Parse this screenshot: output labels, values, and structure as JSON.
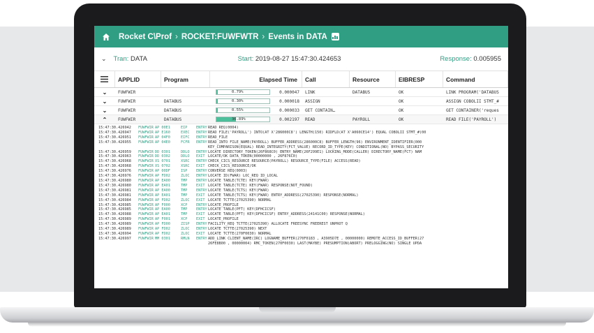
{
  "header": {
    "crumbs": [
      "Rocket C\\Prof",
      "ROCKET:FUWFWTR",
      "Events in DATA"
    ],
    "separator": "›"
  },
  "tran": {
    "tran_label": "Tran:",
    "tran_value": "DATA",
    "start_label": "Start:",
    "start_value": "2019-08-27 15:47:30.424653",
    "response_label": "Response:",
    "response_value": "0.005955"
  },
  "table": {
    "columns": [
      "APPLID",
      "Program",
      "Elapsed Time",
      "Call",
      "Resource",
      "EIBRESP",
      "Command"
    ],
    "rows": [
      {
        "toggle": "⌄",
        "applid": "FUWFWIR",
        "program": "",
        "pct_label": "0.79%",
        "pct": 0.0079,
        "elapsed": "0.000047",
        "call": "LINK",
        "resource": "DATABUS",
        "eibresp": "OK",
        "command": "LINK PROGRAM('DATABUS"
      },
      {
        "toggle": "⌄",
        "applid": "FUWFWIR",
        "program": "DATABUS",
        "pct_label": "0.30%",
        "pct": 0.003,
        "elapsed": "0.000018",
        "call": "ASSIGN",
        "resource": "",
        "eibresp": "OK",
        "command": "ASSIGN COBOLII STMT_#"
      },
      {
        "toggle": "⌄",
        "applid": "FUWFWIR",
        "program": "DATABUS",
        "pct_label": "0.55%",
        "pct": 0.0055,
        "elapsed": "0.000033",
        "call": "GET CONTAIN…",
        "resource": "",
        "eibresp": "OK",
        "command": "GET CONTAINER('reques"
      },
      {
        "toggle": "⌃",
        "applid": "FUWFWIR",
        "program": "DATABUS",
        "pct_label": "36.89%",
        "pct": 0.3689,
        "elapsed": "0.002197",
        "call": "READ",
        "resource": "PAYROLL",
        "eibresp": "OK",
        "command": "READ FILE('PAYROLL')"
      }
    ]
  },
  "log": [
    {
      "ts": "15:47:30.426942",
      "ap": "FUWFWIR",
      "dm": "AP 00E1",
      "op": "EIP",
      "ph": "ENTRY",
      "tx": "READ REQ(0004)"
    },
    {
      "ts": "15:47:30.426947",
      "ap": "FUWFWIR",
      "dm": "AP E160",
      "op": "EXEC",
      "ph": "ENTRY",
      "tx": "READ FILE('PAYROLL') INTO(AT X'286000C8') LENGTH(150) RIDFLD(AT X'A060CE14') EQUAL COBOLII STMT_#(00"
    },
    {
      "ts": "15:47:30.426951",
      "ap": "FUWFWIR",
      "dm": "AP 04F0",
      "op": "EIFC",
      "ph": "ENTRY",
      "tx": "READ_FILE"
    },
    {
      "ts": "15:47:30.426955",
      "ap": "FUWFWIR",
      "dm": "AP 04E0",
      "op": "FCFR",
      "ph": "ENTRY",
      "tx": "READ_INTO FILE_NAME(PAYROLL) BUFFER_ADDRESS(286000C8) BUFFER_LENGTH(96) ENVIRONMENT_IDENTIFIER(000"
    },
    {
      "cont": "KEY_COMPARISON(EQUAL) READ_INTEGRITY(FCT_VALUE) RECORD_ID_TYPE(KEY) CONDITIONAL(NO) BYPASS_SECURITY"
    },
    {
      "ts": "15:47:30.426959",
      "ap": "FUWFWIR",
      "dm": "DD 0301",
      "op": "DDLO",
      "ph": "ENTRY",
      "tx": "LOCATE DIRECTORY_TOKEN(26F868C0) ENTRY_NAME(26F299E1) LOCKING_MODE(CALLER) DIRECTORY_NAME(FCT) NAM"
    },
    {
      "ts": "15:47:30.426963",
      "ap": "FUWFWIR",
      "dm": "DD 0302",
      "op": "DDLO",
      "ph": "EXIT",
      "tx": "LOCATE/OK DATA_TOKEN(00000000 , 26F876C0)"
    },
    {
      "ts": "15:47:30.426968",
      "ap": "FUWFWIR",
      "dm": "XS 0701",
      "op": "XSRC",
      "ph": "ENTRY",
      "tx": "CHECK_CICS_RESOURCE RESOURCE(PAYROLL) RESOURCE_TYPE(FILE) ACCESS(READ)"
    },
    {
      "ts": "15:47:30.426968",
      "ap": "FUWFWIR",
      "dm": "XS 0702",
      "op": "XSRC",
      "ph": "EXIT",
      "tx": "CHECK_CICS_RESOURCE/OK"
    },
    {
      "ts": "15:47:30.426976",
      "ap": "FUWFWIR",
      "dm": "AP 00DF",
      "op": "ISP",
      "ph": "ENTRY",
      "tx": "CONVERSE REQ(0003)"
    },
    {
      "ts": "15:47:30.426976",
      "ap": "FUWFWIR",
      "dm": "AP FD02",
      "op": "ZLOC",
      "ph": "ENTRY",
      "tx": "LOCATE ID(FWAR) LOC_REQ ID_LOCAL"
    },
    {
      "ts": "15:47:30.426980",
      "ap": "FUWFWIR",
      "dm": "AP EA00",
      "op": "TMP",
      "ph": "ENTRY",
      "tx": "LOCATE TABLE(TCTE) KEY(FWAR)"
    },
    {
      "ts": "15:47:30.426980",
      "ap": "FUWFWIR",
      "dm": "AP EA01",
      "op": "TMP",
      "ph": "EXIT",
      "tx": "LOCATE TABLE(TCTE) KEY(FWAR) RESPONSE(NOT_FOUND)"
    },
    {
      "ts": "15:47:30.426981",
      "ap": "FUWFWIR",
      "dm": "AP EA00",
      "op": "TMP",
      "ph": "ENTRY",
      "tx": "LOCATE TABLE(TCTS) KEY(FWAR)"
    },
    {
      "ts": "15:47:30.426981",
      "ap": "FUWFWIR",
      "dm": "AP EA01",
      "op": "TMP",
      "ph": "EXIT",
      "tx": "LOCATE TABLE(TCTS) KEY(FWAR) ENTRY_ADDRESS(27025390) RESPONSE(NORMAL)"
    },
    {
      "ts": "15:47:30.426984",
      "ap": "FUWFWIR",
      "dm": "AP FD02",
      "op": "ZLOC",
      "ph": "EXIT",
      "tx": "LOCATE TCTTE(27025390) NORMAL"
    },
    {
      "ts": "15:47:30.426985",
      "ap": "FUWFWIR",
      "dm": "AP F000",
      "op": "XCP",
      "ph": "ENTRY",
      "tx": "LOCATE_PROFILE"
    },
    {
      "ts": "15:47:30.426985",
      "ap": "FUWFWIR",
      "dm": "AP EA00",
      "op": "TMP",
      "ph": "ENTRY",
      "tx": "LOCATE TABLE(PFT) KEY(DFHCICSF)"
    },
    {
      "ts": "15:47:30.426988",
      "ap": "FUWFWIR",
      "dm": "AP EA01",
      "op": "TMP",
      "ph": "EXIT",
      "tx": "LOCATE TABLE(PFT) KEY(DFHCICSF) ENTRY_ADDRESS(24141C00) RESPONSE(NORMAL)"
    },
    {
      "ts": "15:47:30.426989",
      "ap": "FUWFWIR",
      "dm": "AP F001",
      "op": "XCP",
      "ph": "EXIT",
      "tx": "LOCATE_PROFILE"
    },
    {
      "ts": "15:47:30.426989",
      "ap": "FUWFWIR",
      "dm": "AP FD00",
      "op": "ZISP",
      "ph": "ENTRY",
      "tx": "FACILITY_REQ TCTTE(27025390) ALLOCATE FREESYNC FREEREST UNPROT Q"
    },
    {
      "ts": "15:47:30.426989",
      "ap": "FUWFWIR",
      "dm": "AP FD02",
      "op": "ZLOC",
      "ph": "ENTRY",
      "tx": "LOCATE TCTTE(27025390) NEXT"
    },
    {
      "ts": "15:47:30.426994",
      "ap": "FUWFWIR",
      "dm": "AP FD02",
      "op": "ZLOC",
      "ph": "EXIT",
      "tx": "LOCATE TCTTE(270F0030) NORMAL"
    },
    {
      "ts": "15:47:30.426997",
      "ap": "FUWFWIR",
      "dm": "MM 0301",
      "op": "RMLN",
      "ph": "ENTRY",
      "tx": "ADD_LINK CLIENT_NAME(IRC) LOGNAME_BUFFER(270F0183 , A3905D7E , 00000000) REMOTE_ACCESS_ID_BUFFER(27"
    },
    {
      "cont": "26FE8B00 , 00000004) RMC_TOKEN(270F0030) LAST(MAYBE) PRESUMPTION(ABORT) PRELOGGING(NO) SINGLE UPDA"
    }
  ]
}
